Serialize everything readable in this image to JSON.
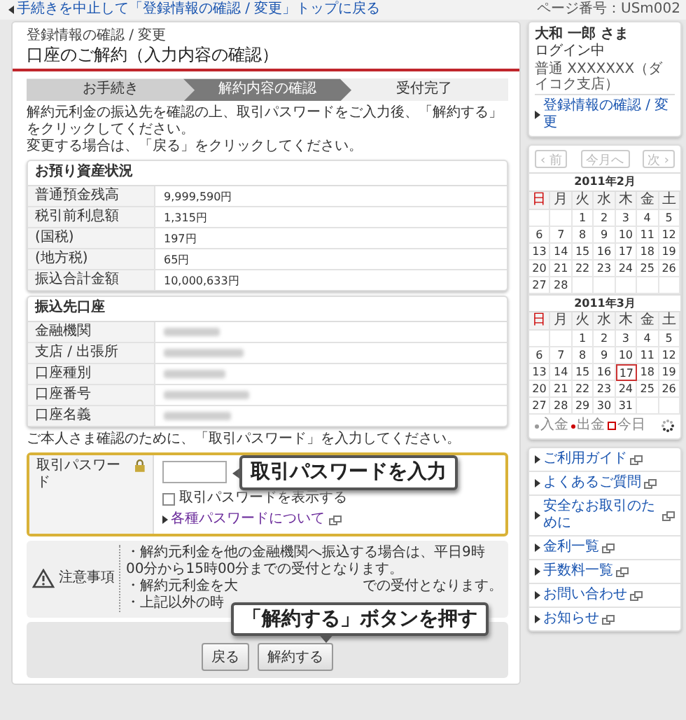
{
  "top_bar": {
    "back_link": "手続きを中止して「登録情報の確認 / 変更」トップに戻る",
    "page_number": "ページ番号：USm002"
  },
  "header": {
    "breadcrumb": "登録情報の確認 / 変更",
    "title": "口座のご解約（入力内容の確認）"
  },
  "steps": [
    {
      "label": "お手続き",
      "done": true,
      "selected": false
    },
    {
      "label": "解約内容の確認",
      "done": false,
      "selected": true
    },
    {
      "label": "受付完了",
      "done": false,
      "selected": false
    }
  ],
  "intro": [
    "解約元利金の振込先を確認の上、取引パスワードをご入力後、「解約する」をクリックしてください。",
    "変更する場合は、「戻る」をクリックしてください。"
  ],
  "tables": [
    {
      "title": "お預り資産状況",
      "rows": [
        {
          "label": "普通預金残高",
          "value": "9,999,590円"
        },
        {
          "label": "税引前利息額",
          "value": "1,315円"
        },
        {
          "label": "(国税)",
          "value": "197円"
        },
        {
          "label": "(地方税)",
          "value": "65円"
        },
        {
          "label": "振込合計金額",
          "value": "10,000,633円"
        }
      ]
    },
    {
      "title": "振込先口座",
      "rows": [
        {
          "label": "金融機関",
          "masked": true
        },
        {
          "label": "支店 / 出張所",
          "masked": true
        },
        {
          "label": "口座種別",
          "masked": true
        },
        {
          "label": "口座番号",
          "masked": true
        },
        {
          "label": "口座名義",
          "masked": true
        }
      ]
    }
  ],
  "password": {
    "prompt": "ご本人さま確認のために、「取引パスワード」を入力してください。",
    "label": "取引パスワード",
    "show_checkbox": {
      "label": "取引パスワードを表示する",
      "checked": false
    },
    "help_link": "各種パスワードについて"
  },
  "notice": {
    "title": "注意事項",
    "lines": [
      [
        "・解約元利金を他の金融機関へ振込する場合は、平日9時00分から15時00分までの受付となります。"
      ],
      [
        "・解約元利金を大",
        "での受付となります。"
      ],
      [
        "・上記以外の時"
      ]
    ]
  },
  "buttons": [
    {
      "label": "戻る"
    },
    {
      "label": "解約する"
    }
  ],
  "callouts": {
    "password_hint": "取引パスワードを入力",
    "submit_hint": "「解約する」ボタンを押す"
  },
  "user": {
    "name": "大和 一郎 さま",
    "status": "ログイン中",
    "account": "普通 XXXXXXX（ダイコク支店）",
    "link": "登録情報の確認 / 変更"
  },
  "calendar": {
    "nav": [
      {
        "label": "‹ 前",
        "disabled": true
      },
      {
        "label": "今月へ",
        "disabled": true
      },
      {
        "label": "次 ›",
        "disabled": true
      }
    ],
    "months": [
      {
        "title": "2011年2月",
        "weekdays": [
          {
            "label": "日",
            "color": "#cc0000"
          },
          {
            "label": "月",
            "color": "#444444"
          },
          {
            "label": "火",
            "color": "#444444"
          },
          {
            "label": "水",
            "color": "#444444"
          },
          {
            "label": "木",
            "color": "#444444"
          },
          {
            "label": "金",
            "color": "#444444"
          },
          {
            "label": "土",
            "color": "#444444"
          }
        ],
        "weeks": [
          {
            "kind": "lead",
            "days": [
              {
                "day": "1",
                "today": false
              },
              {
                "day": "2",
                "today": false
              },
              {
                "day": "3",
                "today": false
              },
              {
                "day": "4",
                "today": false
              },
              {
                "day": "5",
                "today": false
              }
            ]
          },
          {
            "kind": "full",
            "days": [
              {
                "day": "6",
                "today": false
              },
              {
                "day": "7",
                "today": false
              },
              {
                "day": "8",
                "today": false
              },
              {
                "day": "9",
                "today": false
              },
              {
                "day": "10",
                "today": false
              },
              {
                "day": "11",
                "today": false
              },
              {
                "day": "12",
                "today": false
              }
            ]
          },
          {
            "kind": "full",
            "days": [
              {
                "day": "13",
                "today": false
              },
              {
                "day": "14",
                "today": false
              },
              {
                "day": "15",
                "today": false
              },
              {
                "day": "16",
                "today": false
              },
              {
                "day": "17",
                "today": false
              },
              {
                "day": "18",
                "today": false
              },
              {
                "day": "19",
                "today": false
              }
            ]
          },
          {
            "kind": "full",
            "days": [
              {
                "day": "20",
                "today": false
              },
              {
                "day": "21",
                "today": false
              },
              {
                "day": "22",
                "today": false
              },
              {
                "day": "23",
                "today": false
              },
              {
                "day": "24",
                "today": false
              },
              {
                "day": "25",
                "today": false
              },
              {
                "day": "26",
                "today": false
              }
            ]
          },
          {
            "kind": "trail",
            "days": [
              {
                "day": "27",
                "today": false
              },
              {
                "day": "28",
                "today": false
              }
            ]
          }
        ]
      },
      {
        "title": "2011年3月",
        "weekdays": [
          {
            "label": "日",
            "color": "#cc0000"
          },
          {
            "label": "月",
            "color": "#444444"
          },
          {
            "label": "火",
            "color": "#444444"
          },
          {
            "label": "水",
            "color": "#444444"
          },
          {
            "label": "木",
            "color": "#444444"
          },
          {
            "label": "金",
            "color": "#444444"
          },
          {
            "label": "土",
            "color": "#444444"
          }
        ],
        "weeks": [
          {
            "kind": "lead",
            "days": [
              {
                "day": "1",
                "today": false
              },
              {
                "day": "2",
                "today": false
              },
              {
                "day": "3",
                "today": false
              },
              {
                "day": "4",
                "today": false
              },
              {
                "day": "5",
                "today": false
              }
            ]
          },
          {
            "kind": "full",
            "days": [
              {
                "day": "6",
                "today": false
              },
              {
                "day": "7",
                "today": false
              },
              {
                "day": "8",
                "today": false
              },
              {
                "day": "9",
                "today": false
              },
              {
                "day": "10",
                "today": false
              },
              {
                "day": "11",
                "today": false
              },
              {
                "day": "12",
                "today": false
              }
            ]
          },
          {
            "kind": "full",
            "days": [
              {
                "day": "13",
                "today": false
              },
              {
                "day": "14",
                "today": false
              },
              {
                "day": "15",
                "today": false
              },
              {
                "day": "16",
                "today": false
              },
              {
                "day": "17",
                "today": true
              },
              {
                "day": "18",
                "today": false
              },
              {
                "day": "19",
                "today": false
              }
            ]
          },
          {
            "kind": "full",
            "days": [
              {
                "day": "20",
                "today": false
              },
              {
                "day": "21",
                "today": false
              },
              {
                "day": "22",
                "today": false
              },
              {
                "day": "23",
                "today": false
              },
              {
                "day": "24",
                "today": false
              },
              {
                "day": "25",
                "today": false
              },
              {
                "day": "26",
                "today": false
              }
            ]
          },
          {
            "kind": "trail",
            "days": [
              {
                "day": "27",
                "today": false
              },
              {
                "day": "28",
                "today": false
              },
              {
                "day": "29",
                "today": false
              },
              {
                "day": "30",
                "today": false
              },
              {
                "day": "31",
                "today": false
              }
            ]
          }
        ]
      }
    ],
    "legend": [
      {
        "label": "入金",
        "kind": "dot",
        "color": "#999999"
      },
      {
        "label": "出金",
        "kind": "dot",
        "color": "#cc0000"
      },
      {
        "label": "今日",
        "kind": "square",
        "color": "#cc0000"
      }
    ]
  },
  "links": [
    "ご利用ガイド",
    "よくあるご質問",
    "安全なお取引のために",
    "金利一覧",
    "手数料一覧",
    "お問い合わせ",
    "お知らせ"
  ]
}
